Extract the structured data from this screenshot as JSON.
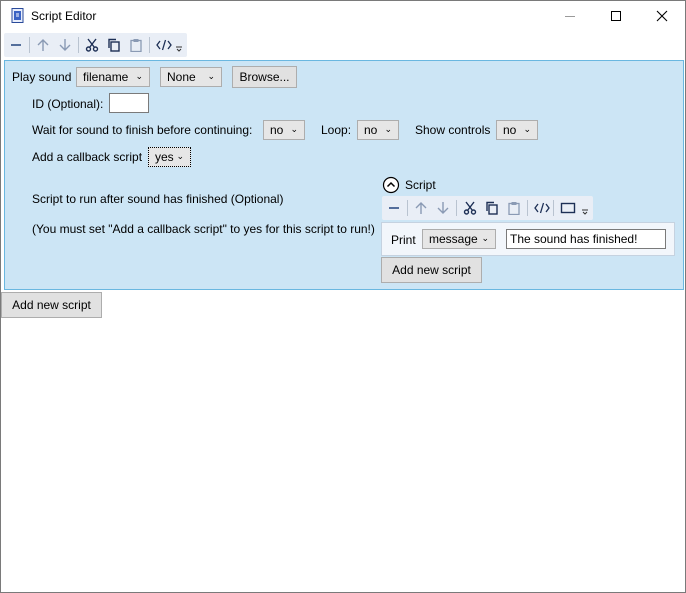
{
  "window": {
    "title": "Script Editor"
  },
  "play_sound": {
    "label": "Play sound",
    "source_select": "filename",
    "file_select": "None",
    "browse_button": "Browse...",
    "id_label": "ID (Optional):",
    "id_value": "",
    "wait_label": "Wait for sound to finish before continuing:",
    "wait_value": "no",
    "loop_label": "Loop:",
    "loop_value": "no",
    "show_controls_label": "Show controls",
    "show_controls_value": "no",
    "callback_label": "Add a callback script",
    "callback_value": "yes",
    "after_label": "Script to run after sound has finished  (Optional)",
    "note_label": "(You must set \"Add a callback script\" to yes for this script to run!)"
  },
  "sub_script": {
    "header": "Script",
    "print_label": "Print",
    "print_type": "message",
    "print_value": "The sound has finished!",
    "add_button": "Add new script"
  },
  "main": {
    "add_button": "Add new script"
  },
  "colors": {
    "panel_bg": "#cce5f5",
    "panel_border": "#6ab7e0",
    "toolbar_bg": "#e9eef6",
    "icon_color": "#2f4f86"
  }
}
